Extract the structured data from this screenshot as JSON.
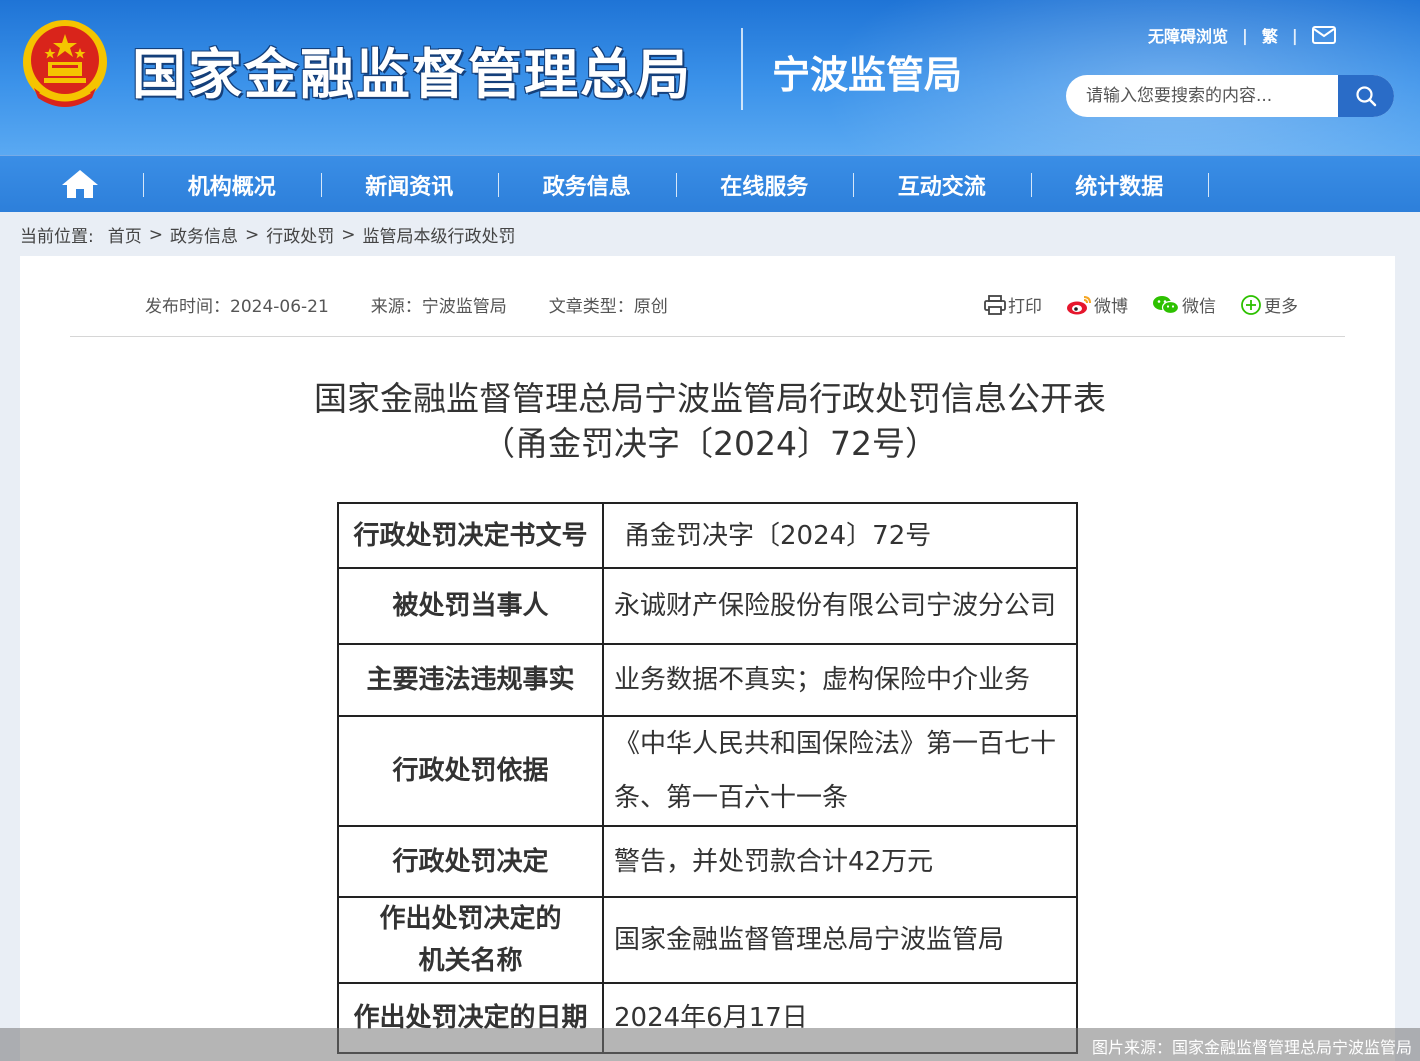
{
  "header": {
    "site_title": "国家金融监督管理总局",
    "sub_title": "宁波监管局",
    "links": {
      "accessibility": "无障碍浏览",
      "traditional": "繁"
    },
    "search_placeholder": "请输入您要搜索的内容..."
  },
  "nav": {
    "items": [
      "机构概况",
      "新闻资讯",
      "政务信息",
      "在线服务",
      "互动交流",
      "统计数据"
    ]
  },
  "breadcrumb": {
    "label": "当前位置:",
    "items": [
      "首页",
      "政务信息",
      "行政处罚",
      "监管局本级行政处罚"
    ]
  },
  "meta": {
    "publish": "发布时间：2024-06-21",
    "source": "来源：宁波监管局",
    "type": "文章类型：原创"
  },
  "share": {
    "print": "打印",
    "weibo": "微博",
    "wechat": "微信",
    "more": "更多"
  },
  "article": {
    "title_line1": "国家金融监督管理总局宁波监管局行政处罚信息公开表",
    "title_line2": "（甬金罚决字〔2024〕72号）"
  },
  "table": {
    "rows": [
      {
        "key": "行政处罚决定书文号",
        "value": "甬金罚决字〔2024〕72号"
      },
      {
        "key": "被处罚当事人",
        "value": "永诚财产保险股份有限公司宁波分公司"
      },
      {
        "key": "主要违法违规事实",
        "value": "业务数据不真实；虚构保险中介业务"
      },
      {
        "key": "行政处罚依据",
        "value": "《中华人民共和国保险法》第一百七十条、第一百六十一条"
      },
      {
        "key": "行政处罚决定",
        "value": "警告，并处罚款合计42万元"
      },
      {
        "key_line1": "作出处罚决定的",
        "key_line2": "机关名称",
        "value": "国家金融监督管理总局宁波监管局"
      },
      {
        "key": "作出处罚决定的日期",
        "value": "2024年6月17日"
      }
    ]
  },
  "caption": "图片来源：国家金融监督管理总局宁波监管局",
  "colors": {
    "header_blue": "#2d7fda",
    "search_button": "#2a6cc7",
    "emblem_red": "#d9241b",
    "emblem_gold": "#f5c400"
  }
}
